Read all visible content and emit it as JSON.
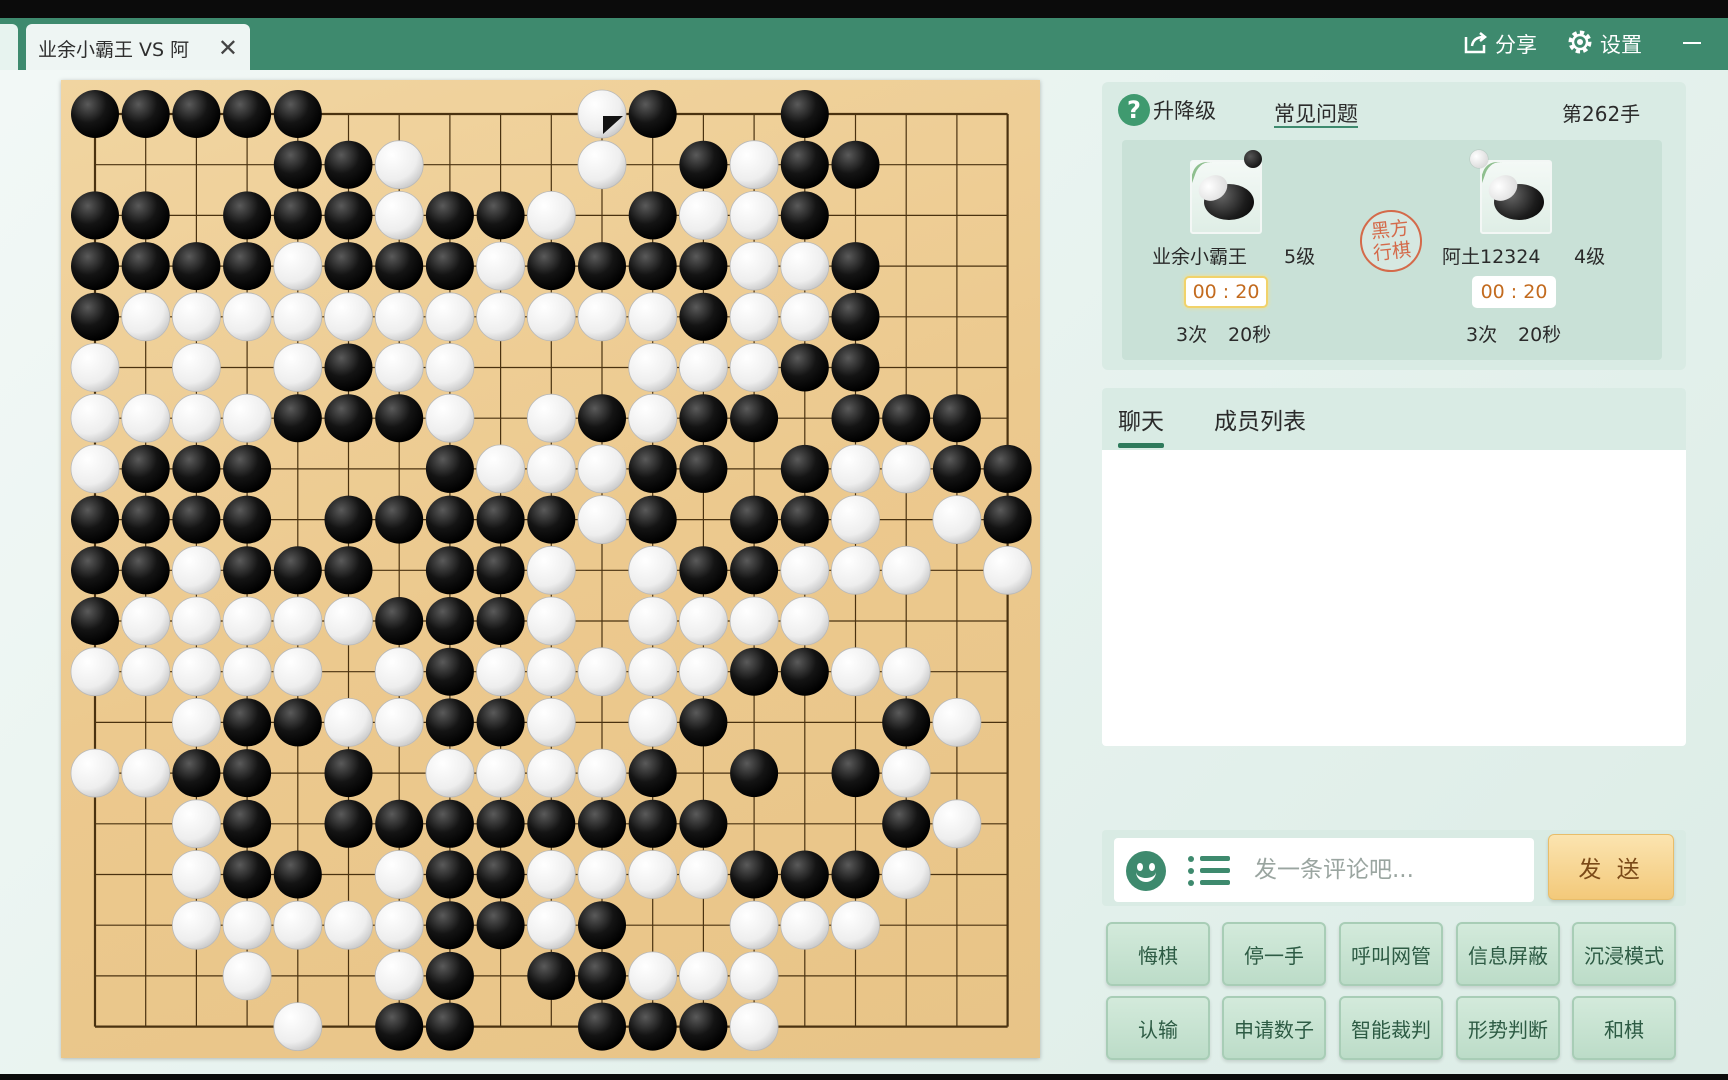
{
  "tab": {
    "title": "业余小霸王 VS 阿",
    "close_glyph": "✕"
  },
  "titlebar": {
    "share_label": "分享",
    "settings_label": "设置"
  },
  "game": {
    "levels_label": "升降级",
    "faq_label": "常见问题",
    "move_count": "第262手",
    "turn_line1": "黑方",
    "turn_line2": "行棋",
    "black": {
      "name": "业余小霸王",
      "rank": "5级",
      "clock": "00 : 20",
      "byoyomi_count": "3次",
      "byoyomi_time": "20秒"
    },
    "white": {
      "name": "阿土12324",
      "rank": "4级",
      "clock": "00 : 20",
      "byoyomi_count": "3次",
      "byoyomi_time": "20秒"
    }
  },
  "board": {
    "size": 19,
    "last_move": "white",
    "rows": [
      "BBBBB.....WB..B....",
      "....BBW...W.BWBB...",
      "BB.BBBWBBW.BWWB....",
      "BBBBWBBBWBBBBWWB...",
      "BWWWWWWWWWWWBWWB...",
      "W.W.WBWW...WWWBB...",
      "WWWWBBBW.WBWBB.BBB.",
      "WBBB...BWWWBB.BWWBB",
      "BBBB.BBBBBWB.BBW.WB",
      "BBWBBB.BBW.WBBWWW.W",
      "BWWWWWBBBW.WWWW....",
      "WWWWW.WBWWWWWBBWW..",
      "..WBBWWBBW.WB...BW.",
      "WWBB.B.WWWWB.B.BW..",
      "..WB.BBBBBBBB...BW.",
      "..WBB.WBBWWWWBBBW..",
      "..WWWWWBBWB..WWW...",
      "...W..WB.BBWWW.....",
      "....W.BB..BBBW....."
    ]
  },
  "chat": {
    "tab_chat": "聊天",
    "tab_members": "成员列表",
    "placeholder": "发一条评论吧...",
    "send_label": "发 送"
  },
  "actions": {
    "undo": "悔棋",
    "pass": "停一手",
    "call_admin": "呼叫网管",
    "block_messages": "信息屏蔽",
    "immersive": "沉浸模式",
    "resign": "认输",
    "count_request": "申请数子",
    "ai_judge": "智能裁判",
    "situation": "形势判断",
    "draw": "和棋"
  },
  "icons": [
    "help-icon",
    "share-icon",
    "gear-icon",
    "close-icon",
    "minimize-icon",
    "emoji-icon",
    "list-icon"
  ],
  "colors": {
    "accent": "#3e8a6e",
    "board": "#ecc98e",
    "clock_text": "#c36b1f",
    "seal": "#d46a4a"
  }
}
